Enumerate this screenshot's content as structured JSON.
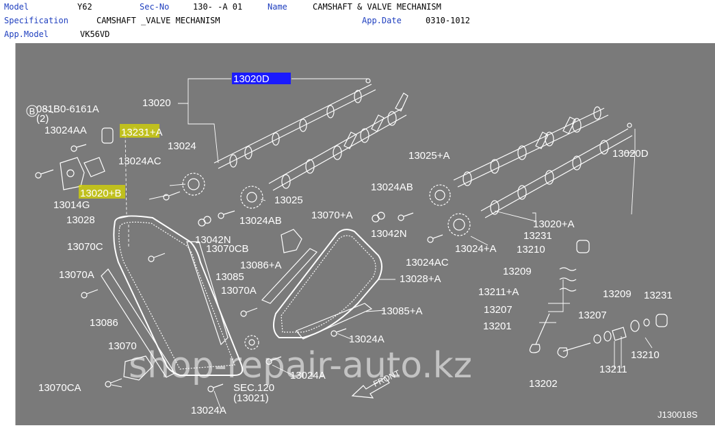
{
  "header": {
    "model_label": "Model",
    "model_value": "Y62",
    "secno_label": "Sec-No",
    "secno_value": "130-   -A 01",
    "name_label": "Name",
    "name_value": "CAMSHAFT & VALVE MECHANISM",
    "spec_label": "Specification",
    "spec_value": "CAMSHAFT _VALVE MECHANISM",
    "appdate_label": "App.Date",
    "appdate_value": "0310-1012",
    "appmodel_label": "App.Model",
    "appmodel_value": "VK56VD"
  },
  "diagram": {
    "callouts": [
      {
        "id": "c13020d_top",
        "text": "13020D",
        "highlight": "blue"
      },
      {
        "id": "c13020",
        "text": "13020"
      },
      {
        "id": "c081b0",
        "text": "081B0-6161A"
      },
      {
        "id": "c2",
        "text": "(2)"
      },
      {
        "id": "c13024aa",
        "text": "13024AA"
      },
      {
        "id": "c13231a",
        "text": "13231+A",
        "highlight": "yellow"
      },
      {
        "id": "c13024",
        "text": "13024"
      },
      {
        "id": "c13024ac_l",
        "text": "13024AC"
      },
      {
        "id": "c13020b",
        "text": "13020+B",
        "highlight": "yellow"
      },
      {
        "id": "c13014g",
        "text": "13014G"
      },
      {
        "id": "c13028",
        "text": "13028"
      },
      {
        "id": "c13025",
        "text": "13025"
      },
      {
        "id": "c13024ab_l",
        "text": "13024AB"
      },
      {
        "id": "c13070a_t",
        "text": "13070+A"
      },
      {
        "id": "c13042n_l",
        "text": "13042N"
      },
      {
        "id": "c13070c",
        "text": "13070C"
      },
      {
        "id": "c13070cb",
        "text": "13070CB"
      },
      {
        "id": "c13086a",
        "text": "13086+A"
      },
      {
        "id": "c13070a_l",
        "text": "13070A"
      },
      {
        "id": "c13085",
        "text": "13085"
      },
      {
        "id": "c13070a_m",
        "text": "13070A"
      },
      {
        "id": "c13086",
        "text": "13086"
      },
      {
        "id": "c13070",
        "text": "13070"
      },
      {
        "id": "c13070ca",
        "text": "13070CA"
      },
      {
        "id": "c13024a_b",
        "text": "13024A"
      },
      {
        "id": "c13024a_m",
        "text": "13024A"
      },
      {
        "id": "c13024a_r",
        "text": "13024A"
      },
      {
        "id": "csec120",
        "text": "SEC.120"
      },
      {
        "id": "c13021",
        "text": "(13021)"
      },
      {
        "id": "cfront",
        "text": "FRONT"
      },
      {
        "id": "c13028a",
        "text": "13028+A"
      },
      {
        "id": "c13085a",
        "text": "13085+A"
      },
      {
        "id": "c13025a",
        "text": "13025+A"
      },
      {
        "id": "c13024ab_r",
        "text": "13024AB"
      },
      {
        "id": "c13042n_r",
        "text": "13042N"
      },
      {
        "id": "c13024ac_r",
        "text": "13024AC"
      },
      {
        "id": "c13024pa",
        "text": "13024+A"
      },
      {
        "id": "c13020d_r",
        "text": "13020D"
      },
      {
        "id": "c13020pa",
        "text": "13020+A"
      },
      {
        "id": "c13231_m",
        "text": "13231"
      },
      {
        "id": "c13210_m",
        "text": "13210"
      },
      {
        "id": "c13209_m",
        "text": "13209"
      },
      {
        "id": "c13211a",
        "text": "13211+A"
      },
      {
        "id": "c13207_m",
        "text": "13207"
      },
      {
        "id": "c13201",
        "text": "13201"
      },
      {
        "id": "c13209_r",
        "text": "13209"
      },
      {
        "id": "c13231_r",
        "text": "13231"
      },
      {
        "id": "c13207_r",
        "text": "13207"
      },
      {
        "id": "c13210_r",
        "text": "13210"
      },
      {
        "id": "c13211",
        "text": "13211"
      },
      {
        "id": "c13202",
        "text": "13202"
      },
      {
        "id": "cref",
        "text": "J130018S"
      }
    ],
    "bolt_marker": "B",
    "watermark": "shop-repair-auto.kz"
  },
  "colors": {
    "panel": "#7a7a7a",
    "line": "#ffffff",
    "highlight_blue": "#1a1aff",
    "highlight_yellow": "#d8d800",
    "header_label": "#1f3fbf"
  }
}
